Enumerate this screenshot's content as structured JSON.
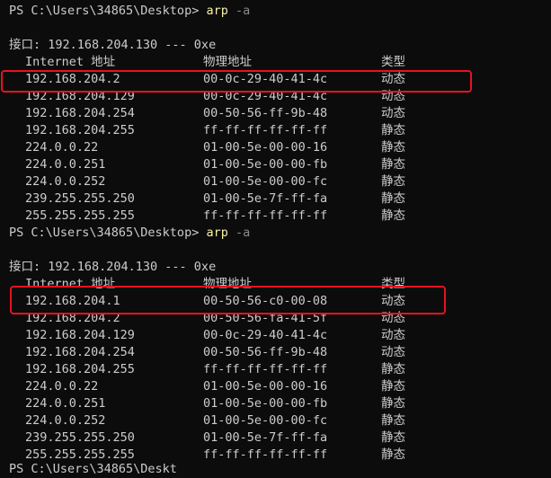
{
  "top_fragment": "",
  "blocks": [
    {
      "prompt": "PS C:\\Users\\34865\\Desktop> ",
      "command": "arp",
      "flag": " -a",
      "interface_line": "接口: 192.168.204.130 --- 0xe",
      "headers": [
        "Internet 地址",
        "物理地址",
        "类型"
      ],
      "rows": [
        [
          "192.168.204.2",
          "00-0c-29-40-41-4c",
          "动态"
        ],
        [
          "192.168.204.129",
          "00-0c-29-40-41-4c",
          "动态"
        ],
        [
          "192.168.204.254",
          "00-50-56-ff-9b-48",
          "动态"
        ],
        [
          "192.168.204.255",
          "ff-ff-ff-ff-ff-ff",
          "静态"
        ],
        [
          "224.0.0.22",
          "01-00-5e-00-00-16",
          "静态"
        ],
        [
          "224.0.0.251",
          "01-00-5e-00-00-fb",
          "静态"
        ],
        [
          "224.0.0.252",
          "01-00-5e-00-00-fc",
          "静态"
        ],
        [
          "239.255.255.250",
          "01-00-5e-7f-ff-fa",
          "静态"
        ],
        [
          "255.255.255.255",
          "ff-ff-ff-ff-ff-ff",
          "静态"
        ]
      ]
    },
    {
      "prompt": "PS C:\\Users\\34865\\Desktop> ",
      "command": "arp",
      "flag": " -a",
      "interface_line": "接口: 192.168.204.130 --- 0xe",
      "headers": [
        "Internet 地址",
        "物理地址",
        "类型"
      ],
      "rows": [
        [
          "192.168.204.1",
          "00-50-56-c0-00-08",
          "动态"
        ],
        [
          "192.168.204.2",
          "00-50-56-fa-41-5f",
          "动态"
        ],
        [
          "192.168.204.129",
          "00-0c-29-40-41-4c",
          "动态"
        ],
        [
          "192.168.204.254",
          "00-50-56-ff-9b-48",
          "动态"
        ],
        [
          "192.168.204.255",
          "ff-ff-ff-ff-ff-ff",
          "静态"
        ],
        [
          "224.0.0.22",
          "01-00-5e-00-00-16",
          "静态"
        ],
        [
          "224.0.0.251",
          "01-00-5e-00-00-fb",
          "静态"
        ],
        [
          "224.0.0.252",
          "01-00-5e-00-00-fc",
          "静态"
        ],
        [
          "239.255.255.250",
          "01-00-5e-7f-ff-fa",
          "静态"
        ],
        [
          "255.255.255.255",
          "ff-ff-ff-ff-ff-ff",
          "静态"
        ]
      ]
    }
  ],
  "bottom_prompt": "PS C:\\Users\\34865\\Deskt",
  "highlight_color": "#e81123"
}
